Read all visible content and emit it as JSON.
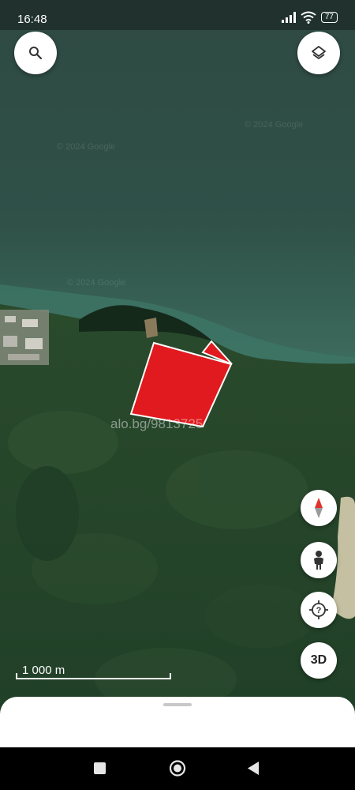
{
  "status_bar": {
    "time": "16:48",
    "battery": "77"
  },
  "map": {
    "watermark": "alo.bg/9813725",
    "scale_label": "1 000 m",
    "copyright": "© 2024 Google",
    "parcel_color": "#e01a1e"
  },
  "controls": {
    "search_icon": "search-icon",
    "layers_icon": "layers-icon",
    "compass_icon": "compass-icon",
    "street_view_icon": "pegman-icon",
    "locate_icon": "my-location-icon",
    "three_d_label": "3D"
  },
  "nav_bar": {
    "icons": [
      "square-icon",
      "circle-icon",
      "back-triangle-icon"
    ]
  }
}
